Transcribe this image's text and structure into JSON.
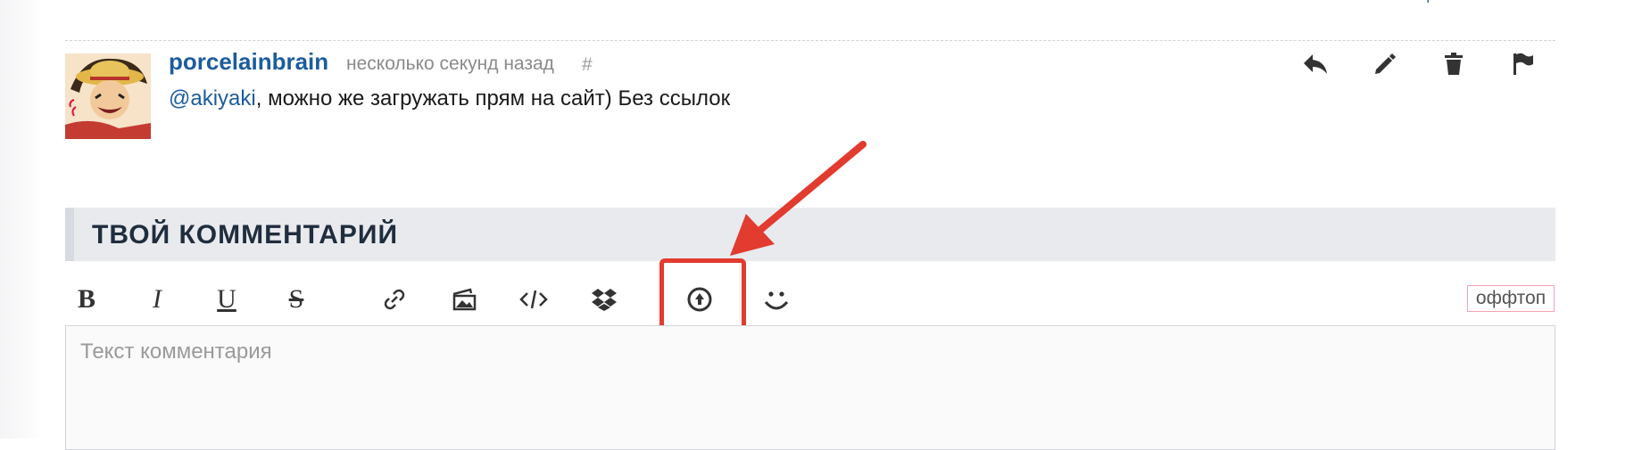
{
  "comment": {
    "username": "porcelainbrain",
    "time": "несколько секунд назад",
    "hash": "#",
    "mention": "@akiyaki",
    "text": ", можно же загружать прям на сайт) Без ссылок",
    "actions": [
      "reply-icon",
      "edit-icon",
      "trash-icon",
      "flag-icon"
    ]
  },
  "form": {
    "heading": "ТВОЙ КОММЕНТАРИЙ",
    "toolbar": {
      "bold": "B",
      "italic": "I",
      "underline": "U",
      "strike": "S",
      "icons": [
        "link-icon",
        "image-icon",
        "code-icon",
        "dropbox-icon",
        "upload-icon",
        "smile-icon"
      ]
    },
    "offtop_label": "оффтоп",
    "placeholder": "Текст комментария"
  },
  "annotation": {
    "color": "#e23b2f",
    "target": "upload-icon"
  },
  "colors": {
    "link": "#1b5c9e",
    "heading_bg": "#e8eaee",
    "offtop_border": "#f2a4b4"
  }
}
